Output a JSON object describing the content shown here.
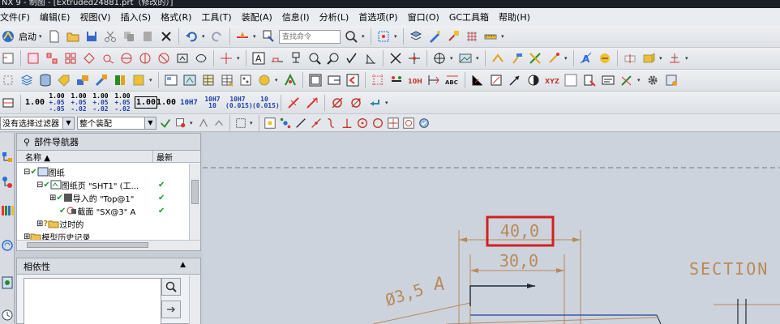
{
  "window": {
    "title": "NX 9 - 制图 - [Extruded24881.prt（修改的）]"
  },
  "menubar": {
    "items": [
      "文件(F)",
      "编辑(E)",
      "视图(V)",
      "插入(S)",
      "格式(R)",
      "工具(T)",
      "装配(A)",
      "信息(I)",
      "分析(L)",
      "首选项(P)",
      "窗口(O)",
      "GC工具箱",
      "帮助(H)"
    ]
  },
  "toolbar": {
    "start_label": "启动",
    "search_placeholder": "查找命令"
  },
  "tolerance_buttons": [
    {
      "top": "1.00",
      "mid": "",
      "bot": ""
    },
    {
      "top": "1.00",
      "mid": "+.05",
      "bot": "-.05"
    },
    {
      "top": "1.00",
      "mid": "+.05",
      "bot": "-.02"
    },
    {
      "top": "1.00",
      "mid": "+.05",
      "bot": "-.02"
    },
    {
      "top": "1.00",
      "mid": "+.05",
      "bot": "-.02"
    },
    {
      "top": "1.00",
      "mid": "",
      "bot": ""
    },
    {
      "top": "1.00",
      "mid": "",
      "bot": ""
    },
    {
      "top": "10H7",
      "mid": "",
      "bot": ""
    },
    {
      "top": "10H7",
      "mid": "10",
      "bot": ""
    },
    {
      "top": "10H7",
      "mid": "(0.015)",
      "bot": ""
    },
    {
      "top": "10",
      "mid": "(0.015)",
      "bot": ""
    }
  ],
  "selection_bar": {
    "filter_value": "没有选择过滤器",
    "scope_value": "整个装配"
  },
  "navigator": {
    "title": "部件导航器",
    "col_name": "名称",
    "col_latest": "最新",
    "rows": [
      {
        "expander": "⊟",
        "label": "图纸",
        "check": "✔",
        "latest": ""
      },
      {
        "expander": "⊟",
        "label": "图纸页 \"SHT1\" (工...",
        "check": "✔",
        "latest": "✔"
      },
      {
        "expander": "⊞",
        "label": "导入的 \"Top@1\"",
        "check": "✔",
        "latest": "✔"
      },
      {
        "expander": "",
        "label": "截面 \"SX@3\" A",
        "check": "✔",
        "latest": "✔"
      },
      {
        "expander": "⊞",
        "label": "过时的",
        "check": "?",
        "latest": ""
      },
      {
        "expander": "⊞",
        "label": "模型历史记录",
        "check": "",
        "latest": ""
      }
    ]
  },
  "dependencies": {
    "title": "相依性"
  },
  "drawing": {
    "dim_outer": "40,0",
    "dim_inner": "30,0",
    "diameter": "Ø3,5",
    "section_letter": "A",
    "section_label": "SECTION",
    "highlight_color": "#d22020",
    "dim_color": "#b88a5a",
    "line_color": "#1e2a3a"
  }
}
